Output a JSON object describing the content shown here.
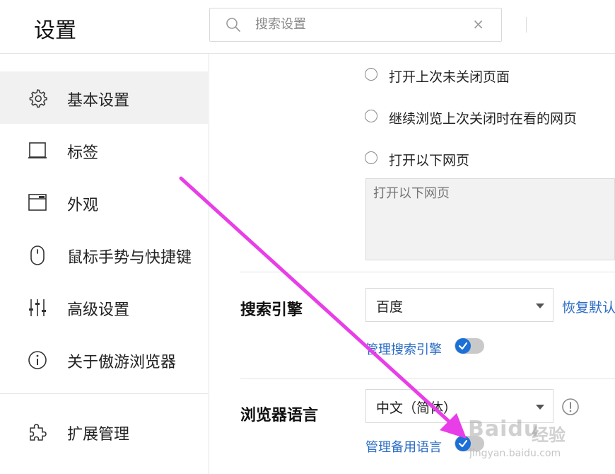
{
  "header": {
    "title": "设置",
    "search_placeholder": "搜索设置",
    "clear_symbol": "×"
  },
  "sidebar": {
    "items": [
      {
        "label": "基本设置",
        "icon": "gear-icon",
        "active": true
      },
      {
        "label": "标签",
        "icon": "tab-icon"
      },
      {
        "label": "外观",
        "icon": "window-icon"
      },
      {
        "label": "鼠标手势与快捷键",
        "icon": "mouse-icon"
      },
      {
        "label": "高级设置",
        "icon": "sliders-icon"
      },
      {
        "label": "关于傲游浏览器",
        "icon": "info-icon"
      }
    ],
    "extensions": {
      "label": "扩展管理",
      "icon": "puzzle-icon"
    }
  },
  "startup": {
    "options": [
      {
        "label": "打开上次未关闭页面",
        "checked": false
      },
      {
        "label": "继续浏览上次关闭时在看的网页",
        "checked": false
      },
      {
        "label": "打开以下网页",
        "checked": false
      }
    ],
    "url_placeholder": "打开以下网页"
  },
  "search_engine": {
    "title": "搜索引擎",
    "selected": "百度",
    "restore_label": "恢复默认",
    "manage_label": "管理搜索引擎",
    "manage_toggle_on": true
  },
  "language": {
    "title": "浏览器语言",
    "selected": "中文（简体）",
    "manage_label": "管理备用语言",
    "manage_toggle_on": true
  },
  "watermark": {
    "brand": "Baidu",
    "brand_cn": "经验",
    "url": "jingyan.baidu.com"
  },
  "colors": {
    "accent": "#2b6cc4",
    "toggle_knob": "#1b6fd6",
    "arrow": "#e83ee8",
    "active_bg": "#f1f1f1"
  }
}
